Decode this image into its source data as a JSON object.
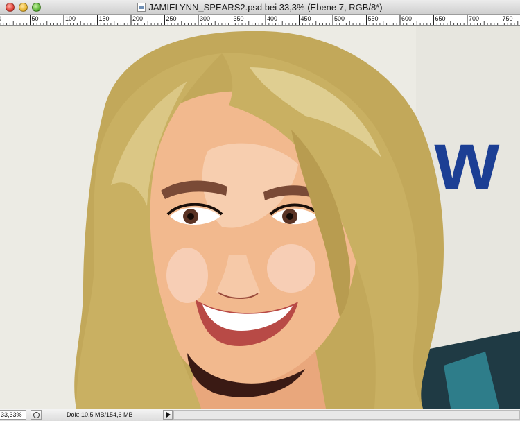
{
  "window": {
    "title": "JAMIELYNN_SPEARS2.psd bei 33,3% (Ebene 7, RGB/8*)",
    "traffic_lights": {
      "close": "#e2453a",
      "minimize": "#e9b630",
      "zoom": "#5fb83a"
    }
  },
  "ruler": {
    "labels": [
      "0",
      "50",
      "100",
      "150",
      "200",
      "250",
      "300",
      "350",
      "400",
      "450",
      "500",
      "550",
      "600",
      "650",
      "700",
      "750"
    ]
  },
  "canvas": {
    "description_icon": "photo-canvas",
    "background_text": "ew",
    "colors": {
      "hair": "#c9b062",
      "skin": "#f2b98e",
      "background_text": "#1c3f94",
      "lips": "#b84a46"
    }
  },
  "statusbar": {
    "zoom": "33,33%",
    "doc_info": "Dok: 10,5 MB/154,6 MB"
  }
}
